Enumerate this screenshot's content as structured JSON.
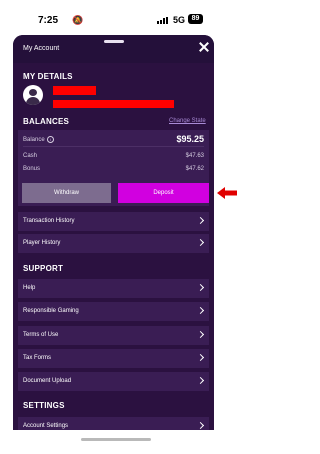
{
  "status_bar": {
    "time": "7:25",
    "network": "5G",
    "battery": "89"
  },
  "header": {
    "title": "My Account"
  },
  "my_details": {
    "title": "MY DETAILS"
  },
  "balances": {
    "title": "BALANCES",
    "change_state": "Change State",
    "balance_label": "Balance",
    "balance_value": "$95.25",
    "cash_label": "Cash",
    "cash_value": "$47.63",
    "bonus_label": "Bonus",
    "bonus_value": "$47.62",
    "withdraw_label": "Withdraw",
    "deposit_label": "Deposit",
    "links": [
      "Transaction History",
      "Player History"
    ]
  },
  "support": {
    "title": "SUPPORT",
    "items": [
      "Help",
      "Responsible Gaming",
      "Terms of Use",
      "Tax Forms",
      "Document Upload"
    ]
  },
  "settings": {
    "title": "SETTINGS",
    "items": [
      "Account Settings"
    ]
  },
  "colors": {
    "sheet_bg": "#2b1140",
    "card_bg": "#3a1d54",
    "deposit": "#d100e0",
    "withdraw": "#7d6c8f",
    "annotation_arrow": "#e00000"
  }
}
